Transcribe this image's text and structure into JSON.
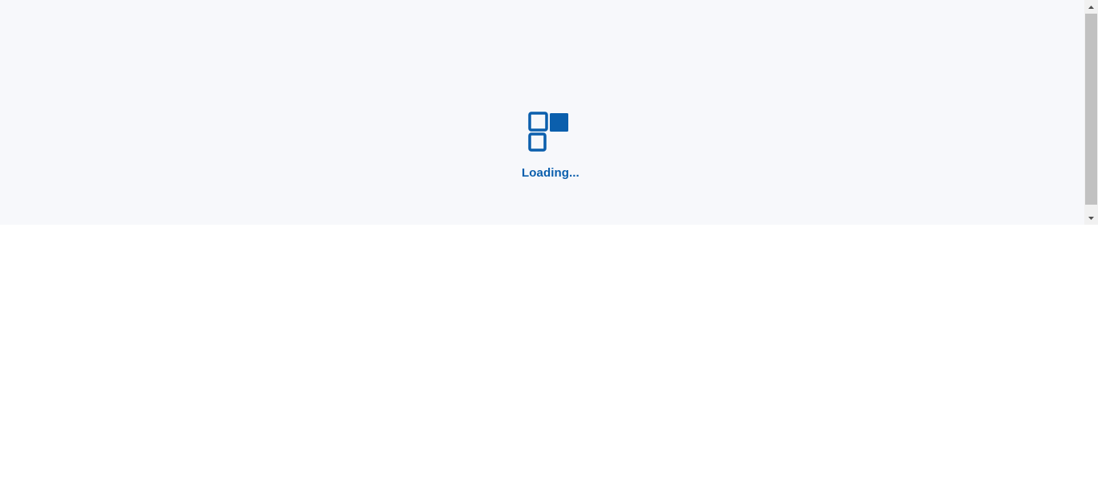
{
  "loader": {
    "text": "Loading...",
    "icon": "grid-squares-icon"
  },
  "scrollbar": {
    "up_icon": "scroll-up-arrow-icon",
    "down_icon": "scroll-down-arrow-icon"
  },
  "colors": {
    "accent": "#0b5fad",
    "page_background": "#f7f8fb",
    "below_background": "#ffffff",
    "scrollbar_track": "#f1f1f1",
    "scrollbar_thumb": "#c1c1c1",
    "scrollbar_arrow": "#505050"
  }
}
